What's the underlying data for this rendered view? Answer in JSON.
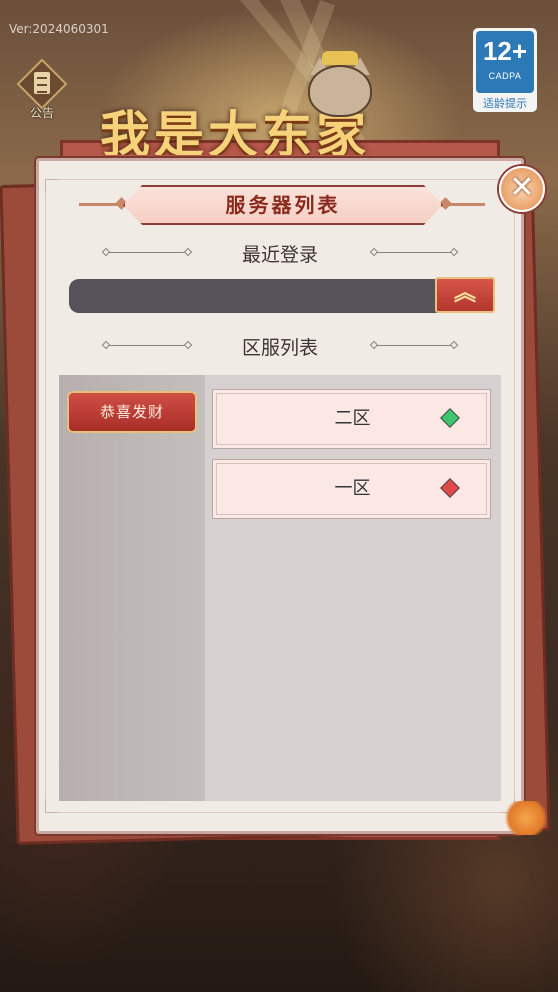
{
  "version": "Ver:2024060301",
  "notice": {
    "label": "公告",
    "icon": "notice-scroll-icon"
  },
  "age_rating": {
    "number": "12+",
    "org": "CADPA",
    "tip": "适龄提示"
  },
  "game_title": "我是大东家",
  "dialog": {
    "title": "服务器列表",
    "close_icon": "close-x-icon",
    "recent_section": "最近登录",
    "collapse_icon": "double-chevron-up-icon",
    "server_section": "区服列表",
    "categories": [
      {
        "label": "恭喜发财",
        "selected": true
      }
    ],
    "servers": [
      {
        "name": "二区",
        "status": "green",
        "status_color": "#3cc46f"
      },
      {
        "name": "一区",
        "status": "red",
        "status_color": "#e0484a"
      }
    ]
  },
  "colors": {
    "accent": "#8a2a1c",
    "button_red": "#c0433a",
    "panel_bg": "#f1ebe6"
  }
}
